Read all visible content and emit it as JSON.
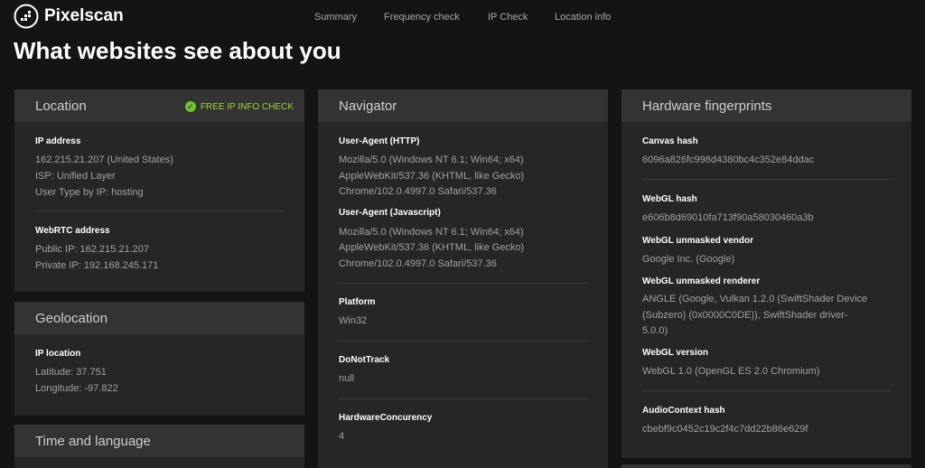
{
  "brand": {
    "name": "Pixelscan"
  },
  "nav": [
    "Summary",
    "Frequency check",
    "IP Check",
    "Location info"
  ],
  "page_title": "What websites see about you",
  "colors": {
    "background": "#141414",
    "card": "#262626",
    "card_header": "#333333",
    "accent_green": "#6ec62c"
  },
  "location": {
    "title": "Location",
    "badge": "FREE IP INFO CHECK",
    "ip_label": "IP address",
    "ip_lines": [
      "162.215.21.207 (United States)",
      "ISP: Unified Layer",
      "User Type by IP: hosting"
    ],
    "webrtc_label": "WebRTC address",
    "webrtc_lines": [
      "Public IP: 162.215.21.207",
      "Private IP: 192.168.245.171"
    ]
  },
  "geolocation": {
    "title": "Geolocation",
    "label": "IP location",
    "lines": [
      "Latitude: 37.751",
      "Longitude: -97.822"
    ]
  },
  "time_language": {
    "title": "Time and language"
  },
  "navigator": {
    "title": "Navigator",
    "ua_http_label": "User-Agent (HTTP)",
    "ua_http_lines": [
      "Mozilla/5.0 (Windows NT 6.1; Win64; x64)",
      "AppleWebKit/537.36 (KHTML, like Gecko)",
      "Chrome/102.0.4997.0 Safari/537.36"
    ],
    "ua_js_label": "User-Agent (Javascript)",
    "ua_js_lines": [
      "Mozilla/5.0 (Windows NT 6.1; Win64; x64)",
      "AppleWebKit/537.36 (KHTML, like Gecko)",
      "Chrome/102.0.4997.0 Safari/537.36"
    ],
    "platform_label": "Platform",
    "platform_value": "Win32",
    "dnt_label": "DoNotTrack",
    "dnt_value": "null",
    "hw_label": "HardwareConcurency",
    "hw_value": "4"
  },
  "hardware": {
    "title": "Hardware fingerprints",
    "canvas_label": "Canvas hash",
    "canvas_value": "6096a826fc998d4380bc4c352e84ddac",
    "webgl_hash_label": "WebGL hash",
    "webgl_hash_value": "e606b8d69010fa713f90a58030460a3b",
    "vendor_label": "WebGL unmasked vendor",
    "vendor_value": "Google Inc. (Google)",
    "renderer_label": "WebGL unmasked renderer",
    "renderer_lines": [
      "ANGLE (Google, Vulkan 1.2.0 (SwiftShader Device",
      "(Subzero) (0x0000C0DE)), SwiftShader driver-",
      "5.0.0)"
    ],
    "version_label": "WebGL version",
    "version_value": "WebGL 1.0 (OpenGL ES 2.0 Chromium)",
    "audio_label": "AudioContext hash",
    "audio_value": "cbebf9c0452c19c2f4c7dd22b86e629f"
  }
}
